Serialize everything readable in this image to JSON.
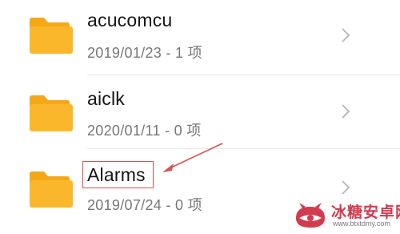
{
  "files": [
    {
      "name": "acucomcu",
      "meta": "2019/01/23 - 1 项",
      "icon": "folder-icon"
    },
    {
      "name": "aiclk",
      "meta": "2020/01/11 - 0 项",
      "icon": "folder-icon"
    },
    {
      "name": "Alarms",
      "meta": "2019/07/24 - 0 项",
      "icon": "folder-icon"
    }
  ],
  "colors": {
    "folder": "#fbb72b",
    "folder_tab": "#f5a817",
    "annotation": "#d9534f",
    "watermark": "#d23a4d"
  },
  "annotation": {
    "highlighted_item": "Alarms"
  },
  "watermark": {
    "title": "冰糖安卓网",
    "url": "www.btxtdmy.com"
  }
}
